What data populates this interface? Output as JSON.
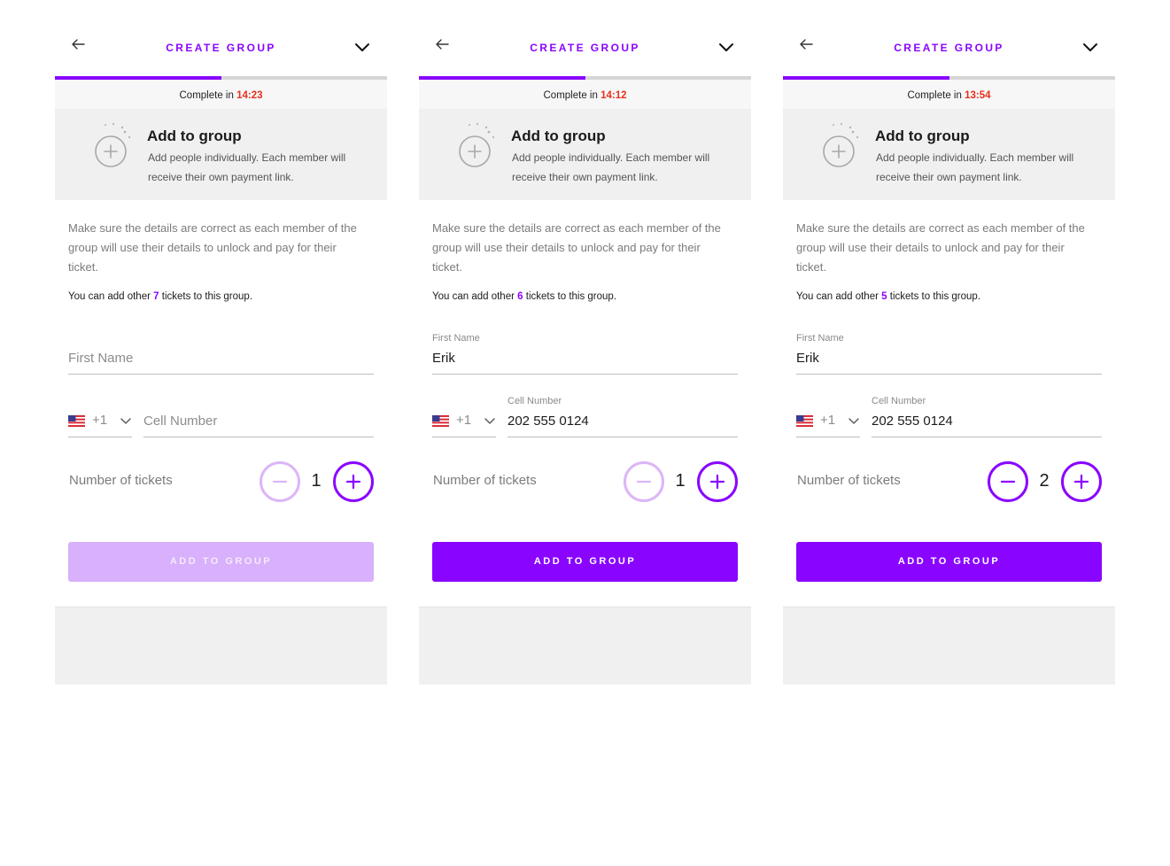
{
  "colors": {
    "accent": "#8a05ff",
    "accent_disabled": "#d8b0fb",
    "timer": "#e8301c"
  },
  "panels": [
    {
      "header": {
        "title": "CREATE GROUP"
      },
      "progress": 0.5,
      "timer": {
        "prefix": "Complete in",
        "value": "14:23"
      },
      "info": {
        "title": "Add to group",
        "description": "Add people individually. Each member will receive their own payment link."
      },
      "body_text": "Make sure the details are correct as each member of the group will use their details to unlock and pay for their ticket.",
      "count": {
        "prefix": "You can add other",
        "number": "7",
        "suffix": "tickets to this group."
      },
      "first_name": {
        "label": "",
        "value": "",
        "placeholder": "First Name"
      },
      "country": {
        "flag": "us-flag-icon",
        "code": "+1"
      },
      "cell": {
        "label": "",
        "value": "",
        "placeholder": "Cell Number"
      },
      "tickets": {
        "label": "Number of tickets",
        "count": "1",
        "minus_enabled": false
      },
      "cta": {
        "label": "ADD TO GROUP",
        "enabled": false
      }
    },
    {
      "header": {
        "title": "CREATE GROUP"
      },
      "progress": 0.5,
      "timer": {
        "prefix": "Complete in",
        "value": "14:12"
      },
      "info": {
        "title": "Add to group",
        "description": "Add people individually. Each member will receive their own payment link."
      },
      "body_text": "Make sure the details are correct as each member of the group will use their details to unlock and pay for their ticket.",
      "count": {
        "prefix": "You can add other",
        "number": "6",
        "suffix": "tickets to this group."
      },
      "first_name": {
        "label": "First Name",
        "value": "Erik",
        "placeholder": ""
      },
      "country": {
        "flag": "us-flag-icon",
        "code": "+1"
      },
      "cell": {
        "label": "Cell Number",
        "value": "202 555 0124",
        "placeholder": ""
      },
      "tickets": {
        "label": "Number of tickets",
        "count": "1",
        "minus_enabled": false
      },
      "cta": {
        "label": "ADD TO GROUP",
        "enabled": true
      }
    },
    {
      "header": {
        "title": "CREATE GROUP"
      },
      "progress": 0.5,
      "timer": {
        "prefix": "Complete in",
        "value": "13:54"
      },
      "info": {
        "title": "Add to group",
        "description": "Add people individually. Each member will receive their own payment link."
      },
      "body_text": "Make sure the details are correct as each member of the group will use their details to unlock and pay for their ticket.",
      "count": {
        "prefix": "You can add other",
        "number": "5",
        "suffix": "tickets to this group."
      },
      "first_name": {
        "label": "First Name",
        "value": "Erik",
        "placeholder": ""
      },
      "country": {
        "flag": "us-flag-icon",
        "code": "+1"
      },
      "cell": {
        "label": "Cell Number",
        "value": "202 555 0124",
        "placeholder": ""
      },
      "tickets": {
        "label": "Number of tickets",
        "count": "2",
        "minus_enabled": true
      },
      "cta": {
        "label": "ADD TO GROUP",
        "enabled": true
      }
    }
  ]
}
